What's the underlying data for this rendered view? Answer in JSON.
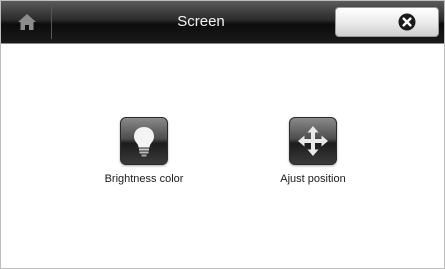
{
  "window": {
    "title": "Screen"
  },
  "toolbar": {
    "home_icon": "home-icon",
    "close_icon": "close-circle-icon"
  },
  "tiles": [
    {
      "label": "Brightness color",
      "icon": "light-bulb-icon"
    },
    {
      "label": "Ajust position",
      "icon": "four-way-arrows-icon"
    }
  ],
  "colors": {
    "titlebar": "#1a1a1a",
    "title_text": "#f2f2f2",
    "icon_tile": "#4d4d4d",
    "background": "#ffffff"
  }
}
